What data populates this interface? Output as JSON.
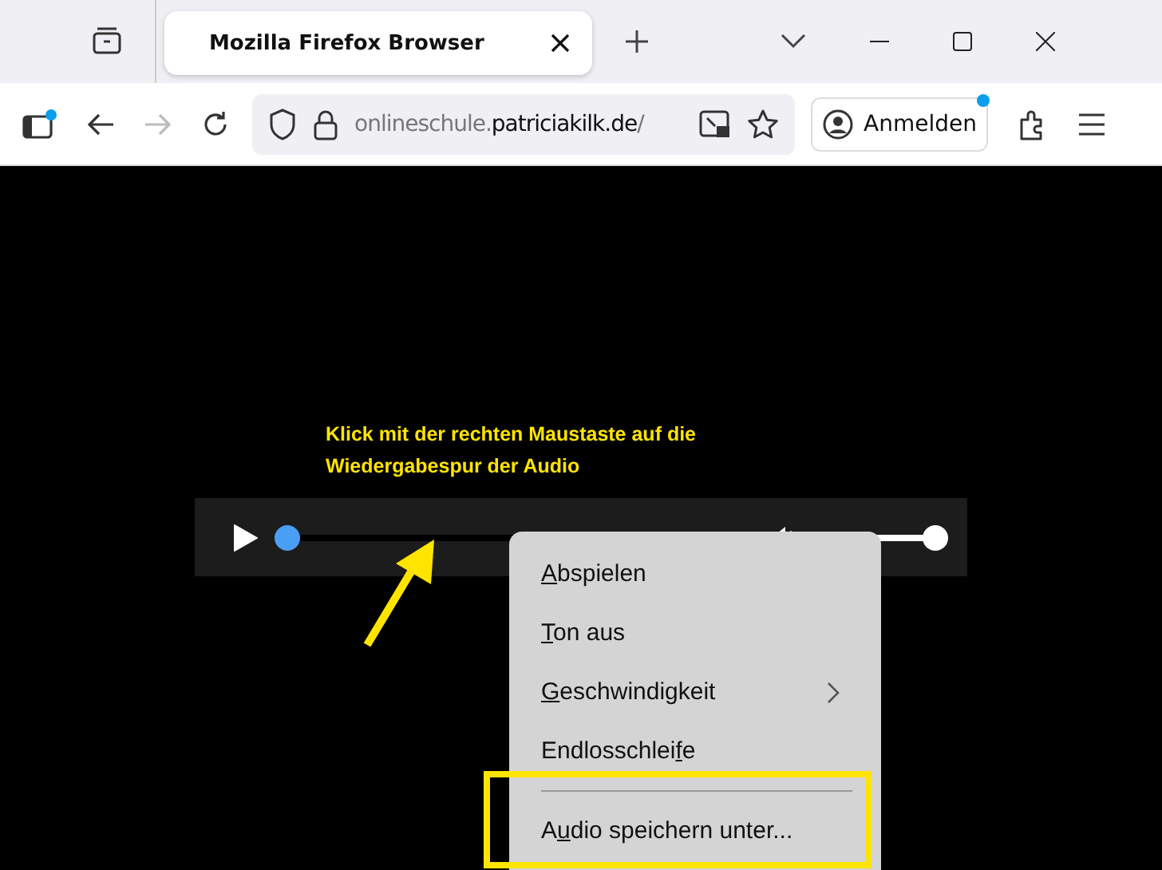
{
  "tabs": [
    {
      "title": "Mozilla Firefox Browser",
      "selected": true
    }
  ],
  "toolbar": {
    "url_host_prefix": "onlineschule.",
    "url_domain": "patriciakilk.de",
    "url_rest": "/",
    "sign_in": "Anmelden"
  },
  "annotation": {
    "text": "Klick mit der rechten Maustaste auf die Wiedergabespur der Audio"
  },
  "player": {
    "playing": false,
    "progress": {
      "level": 0
    },
    "volume": {
      "level": 1
    }
  },
  "context_menu": {
    "items": [
      {
        "kind": "item",
        "key": "A",
        "post": "bspielen",
        "submenu": false
      },
      {
        "kind": "item",
        "key": "T",
        "post": "on aus",
        "submenu": false
      },
      {
        "kind": "item",
        "key": "G",
        "post": "eschwindigkeit",
        "submenu": true
      },
      {
        "kind": "item",
        "pre": "Endlosschlei",
        "key": "f",
        "post": "e",
        "submenu": false
      },
      {
        "kind": "separator"
      },
      {
        "kind": "item",
        "pre": "A",
        "key": "u",
        "post": "dio speichern unter...",
        "submenu": false
      }
    ]
  }
}
